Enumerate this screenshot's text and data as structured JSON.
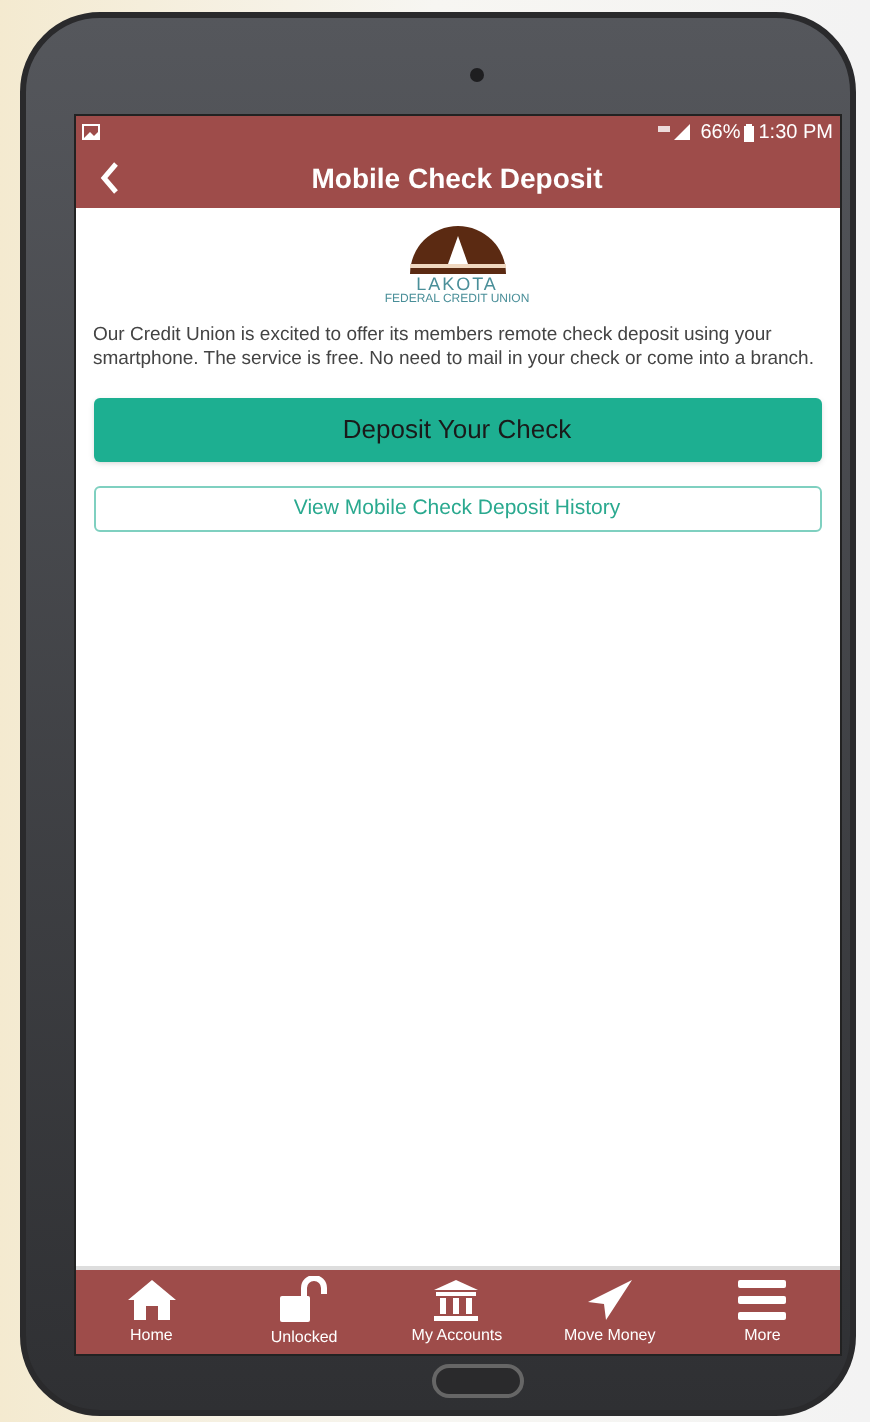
{
  "status_bar": {
    "battery": "66%",
    "time": "1:30 PM"
  },
  "header": {
    "title": "Mobile Check Deposit"
  },
  "logo": {
    "name": "LAKOTA",
    "subtitle": "FEDERAL CREDIT UNION"
  },
  "intro": "Our Credit Union is excited to offer its members remote check deposit using your smartphone. The service is free. No need to mail in your check or come into a branch.",
  "buttons": [
    {
      "label": "Deposit Your Check",
      "kind": "primary"
    },
    {
      "label": "View Mobile Check Deposit History",
      "kind": "outline"
    }
  ],
  "nav": [
    {
      "label": "Home",
      "kind": "home"
    },
    {
      "label": "Unlocked",
      "kind": "unlocked"
    },
    {
      "label": "My Accounts",
      "kind": "bank"
    },
    {
      "label": "Move Money",
      "kind": "send"
    },
    {
      "label": "More",
      "kind": "menu"
    }
  ]
}
